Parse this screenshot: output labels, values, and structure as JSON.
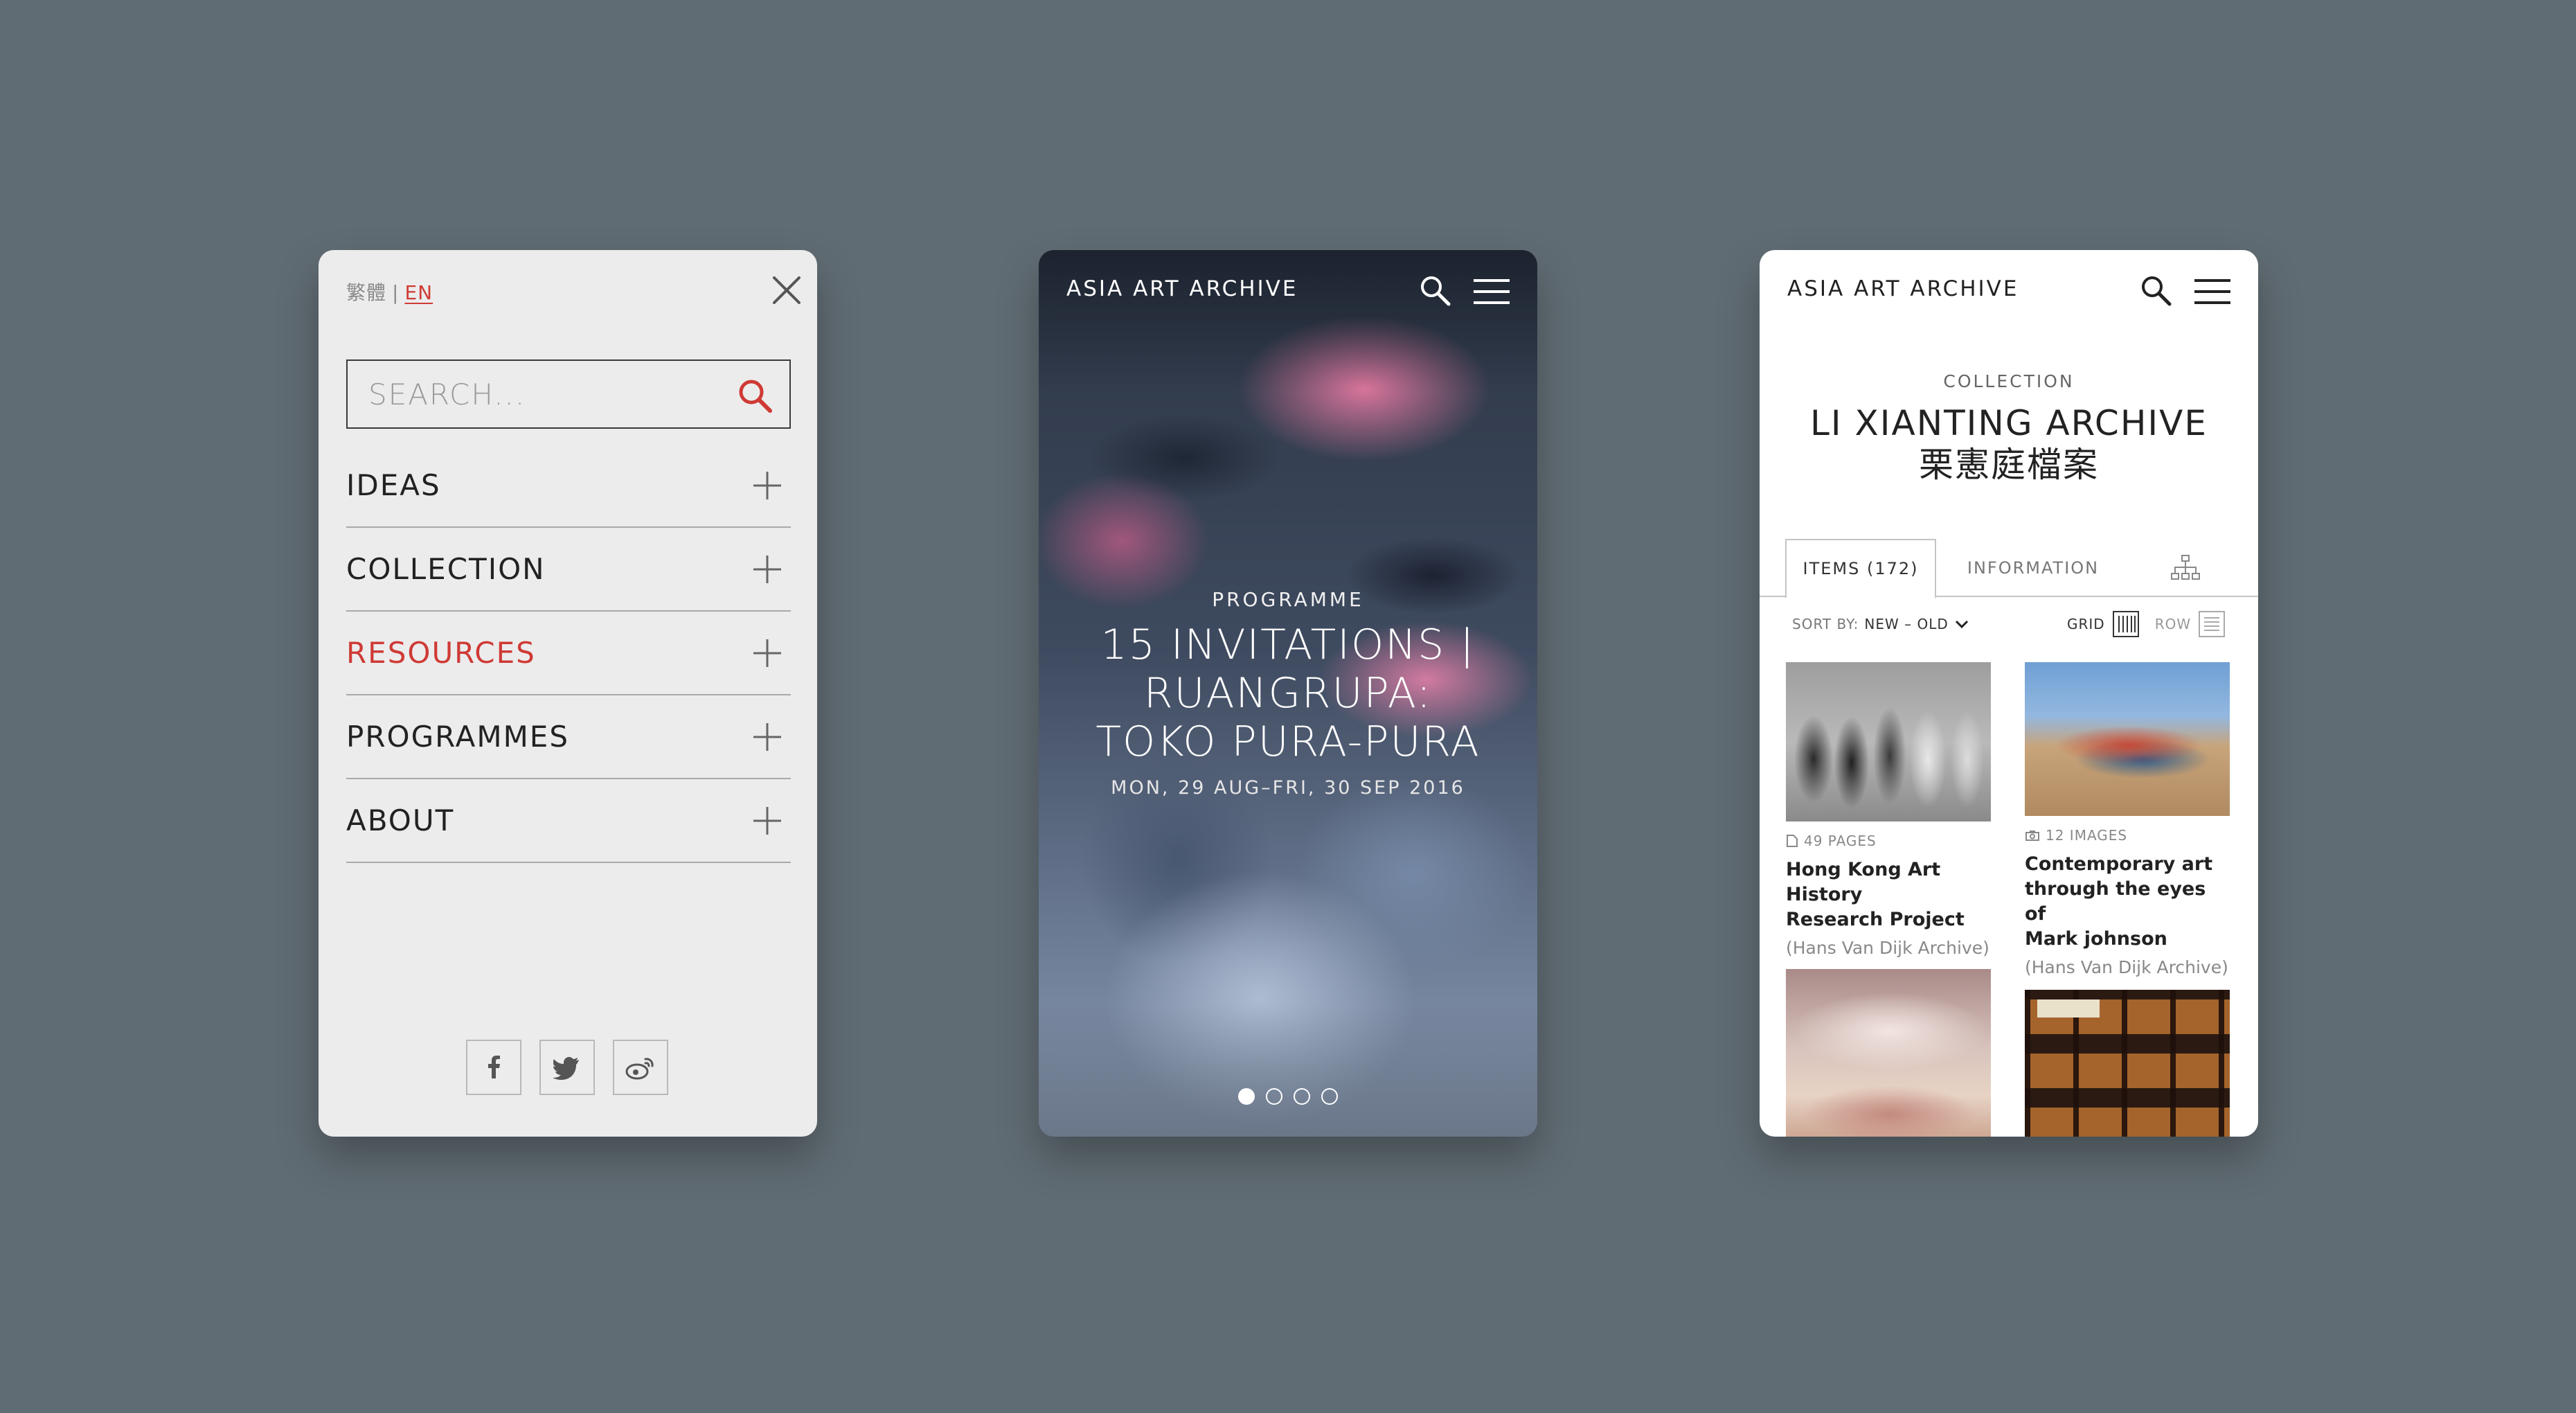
{
  "menu_screen": {
    "lang_zh": "繁體",
    "lang_sep": "|",
    "lang_en": "EN",
    "search_placeholder": "SEARCH...",
    "items": [
      {
        "label": "IDEAS",
        "active": false
      },
      {
        "label": "COLLECTION",
        "active": false
      },
      {
        "label": "RESOURCES",
        "active": true
      },
      {
        "label": "PROGRAMMES",
        "active": false
      },
      {
        "label": "ABOUT",
        "active": false
      }
    ],
    "socials": [
      "facebook-icon",
      "twitter-icon",
      "weibo-icon"
    ],
    "accent_color": "#cf3a35"
  },
  "hero_screen": {
    "brand": "ASIA ART ARCHIVE",
    "kicker": "PROGRAMME",
    "title_line1": "15 INVITATIONS |",
    "title_line2": "RUANGRUPA:",
    "title_line3": "TOKO PURA-PURA",
    "date": "MON, 29 AUG–FRI, 30 SEP 2016",
    "slides_total": 4,
    "slide_active": 1
  },
  "collection_screen": {
    "brand": "ASIA ART ARCHIVE",
    "kicker": "COLLECTION",
    "title": "LI XIANTING ARCHIVE",
    "title_cn": "栗憲庭檔案",
    "tabs": {
      "items": "ITEMS (172)",
      "information": "INFORMATION"
    },
    "sort_label": "SORT BY:",
    "sort_value": "NEW – OLD",
    "view_grid": "GRID",
    "view_row": "ROW",
    "cards": [
      {
        "meta": "49 PAGES",
        "title_line1": "Hong Kong Art History",
        "title_line2": "Research Project",
        "source": "(Hans Van Dijk Archive)"
      },
      {
        "meta": "12 IMAGES",
        "title_line1": "Contemporary art",
        "title_line2": "through the eyes of",
        "title_line3": "Mark johnson",
        "source": "(Hans Van Dijk Archive)"
      }
    ]
  }
}
